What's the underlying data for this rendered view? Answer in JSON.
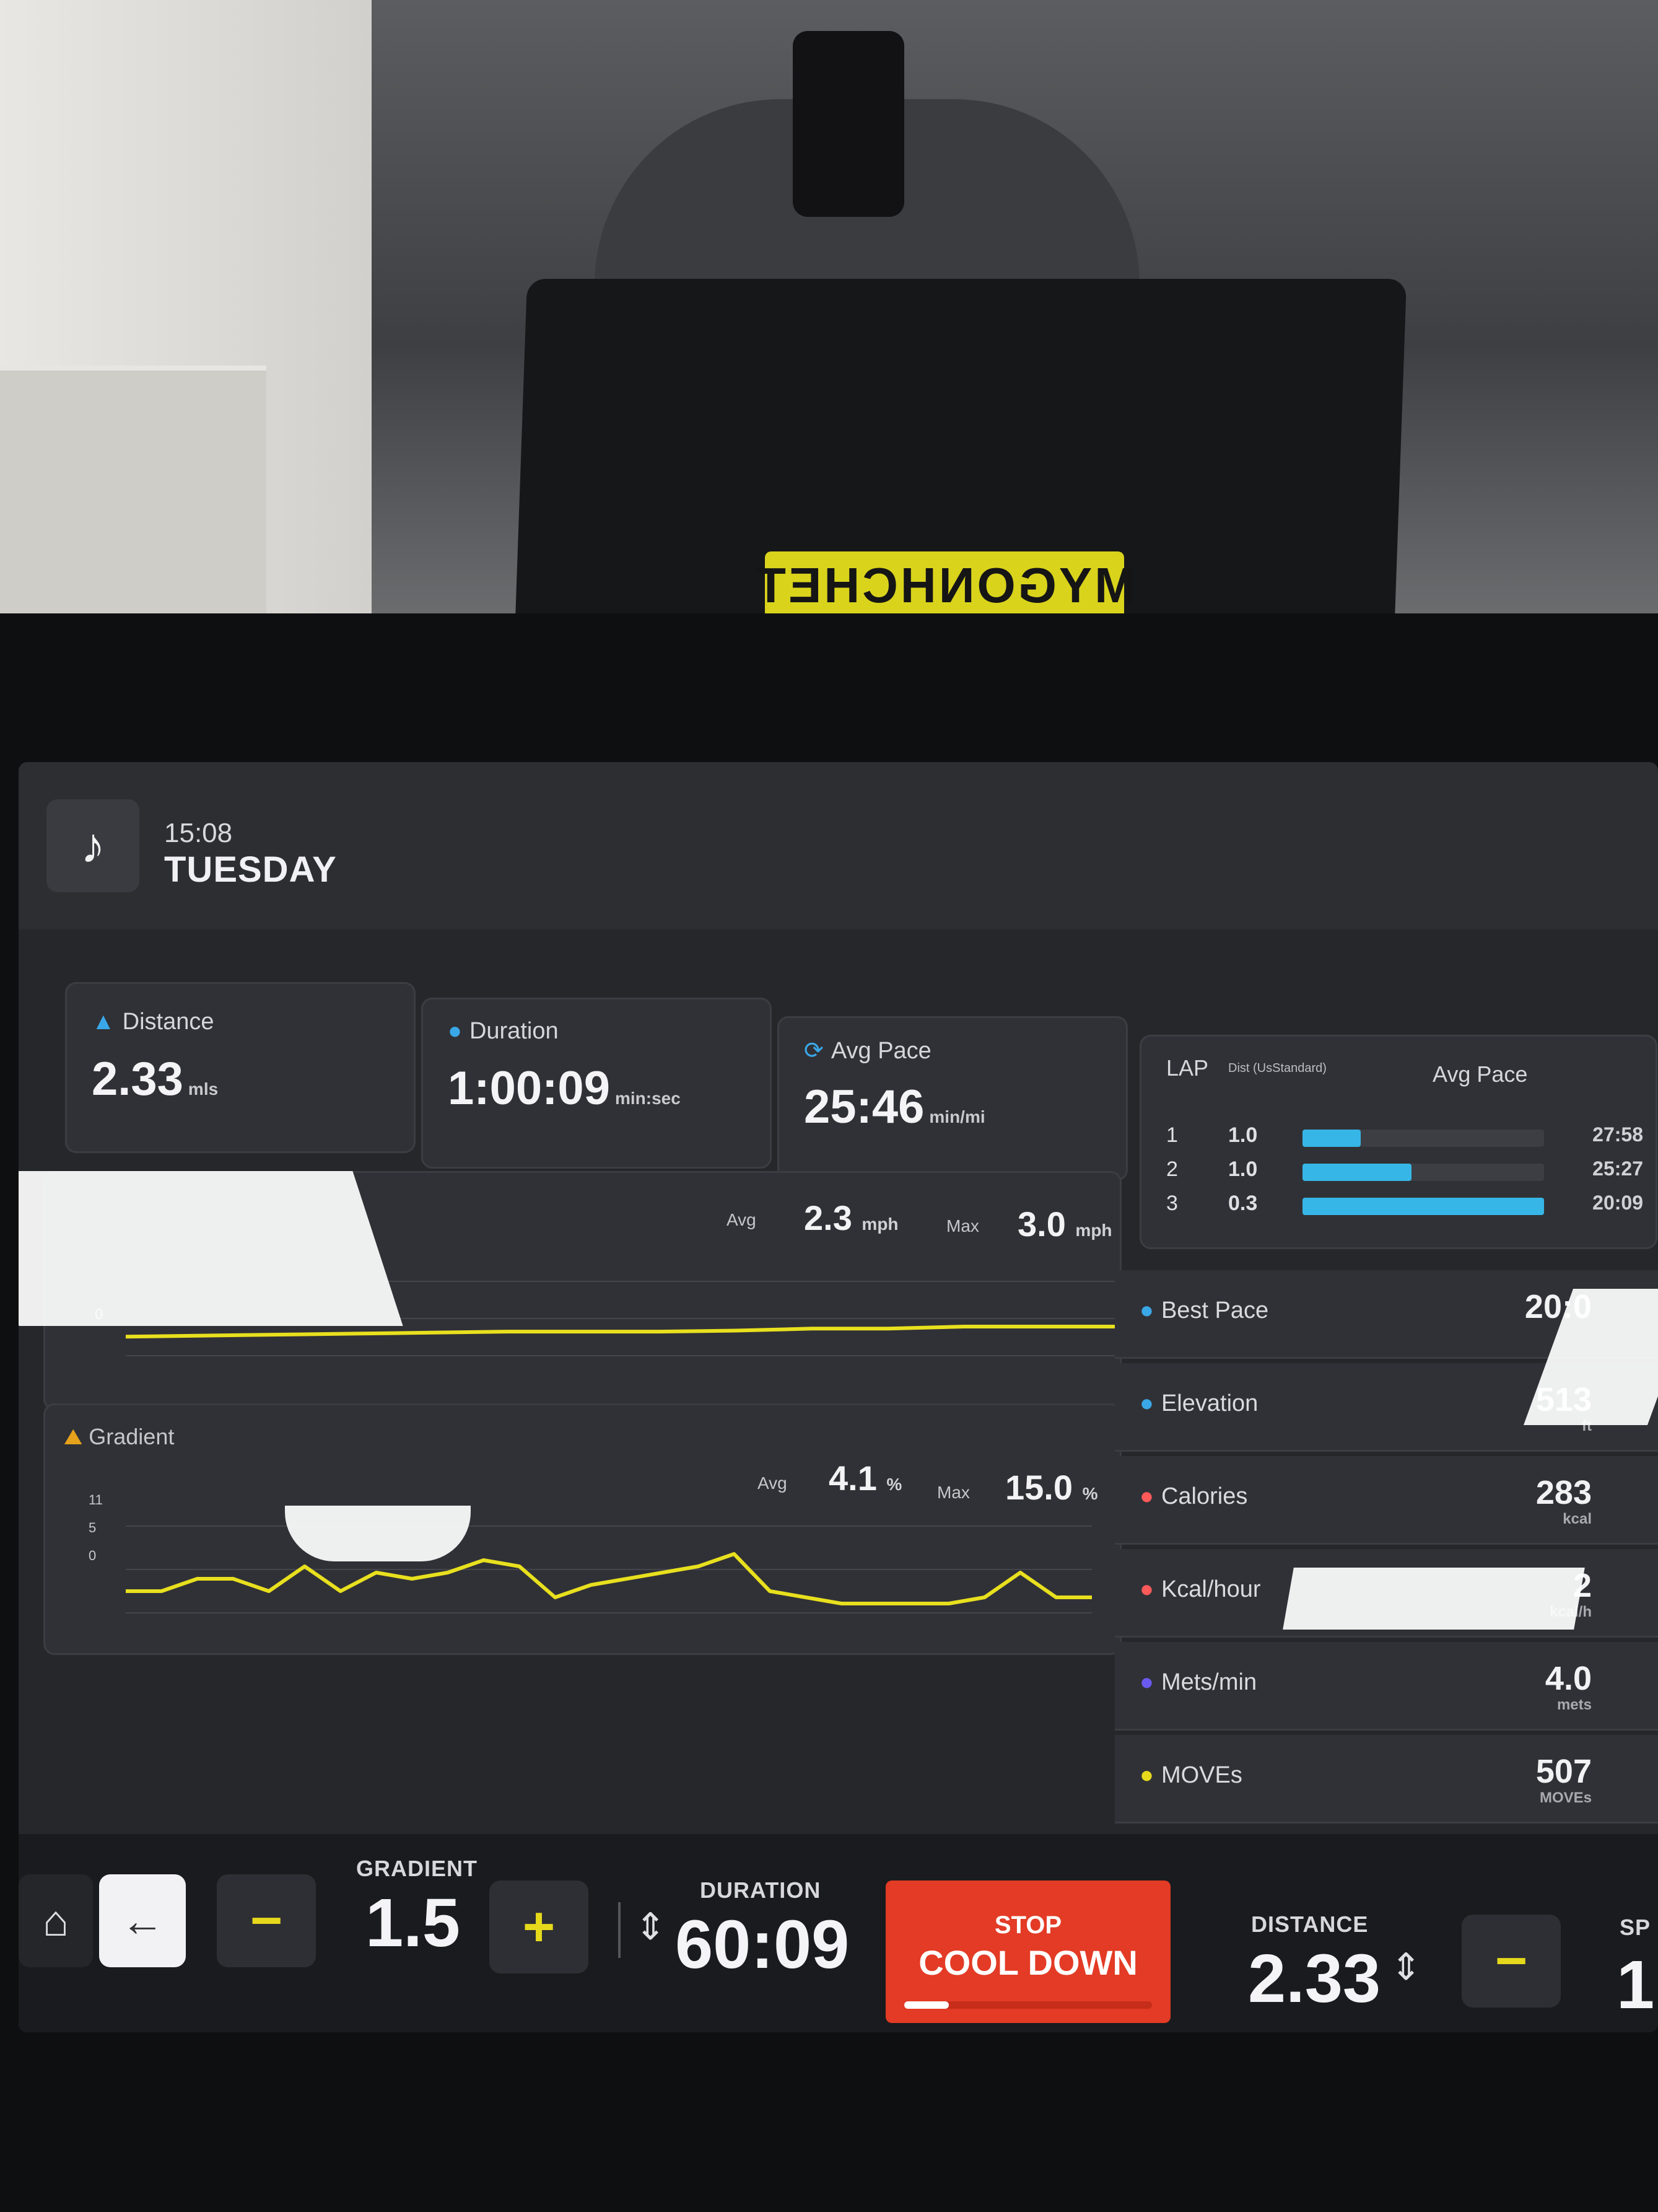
{
  "header": {
    "music_icon": "music-note-icon",
    "time": "15:08",
    "day": "TUESDAY"
  },
  "brand": {
    "label": "MYGONHCHET"
  },
  "metrics": {
    "distance": {
      "label": "Distance",
      "value": "2.33",
      "unit": "mls"
    },
    "duration": {
      "label": "Duration",
      "value": "1:00:09",
      "unit": "min:sec"
    },
    "avg_pace": {
      "label": "Avg Pace",
      "value": "25:46",
      "unit": "min/mi"
    }
  },
  "laps": {
    "col_lap": "LAP",
    "col_dist": "Dist (UsStandard)",
    "col_pace": "Avg Pace",
    "rows": [
      {
        "num": "1",
        "dist": "1.0",
        "pace": "27:58",
        "fill": 0.24
      },
      {
        "num": "2",
        "dist": "1.0",
        "pace": "25:27",
        "fill": 0.45
      },
      {
        "num": "3",
        "dist": "0.3",
        "pace": "20:09",
        "fill": 1.0
      }
    ]
  },
  "speed_chart": {
    "avg_label": "Avg",
    "avg_value": "2.3",
    "avg_unit": "mph",
    "max_label": "Max",
    "max_value": "3.0",
    "max_unit": "mph",
    "y_tick": "0"
  },
  "gradient_chart": {
    "title": "Gradient",
    "avg_label": "Avg",
    "avg_value": "4.1",
    "avg_unit": "%",
    "max_label": "Max",
    "max_value": "15.0",
    "max_unit": "%",
    "y_ticks": [
      "11",
      "5",
      "0"
    ]
  },
  "stats": [
    {
      "name": "Best Pace",
      "value": "20:0",
      "unit": "",
      "icon": "pace-icon",
      "color": "#3aa8e8"
    },
    {
      "name": "Elevation",
      "value": "513",
      "unit": "ft",
      "icon": "mountain-icon",
      "color": "#3aa8e8"
    },
    {
      "name": "Calories",
      "value": "283",
      "unit": "kcal",
      "icon": "flame-icon",
      "color": "#ff5a5a"
    },
    {
      "name": "Kcal/hour",
      "value": "2",
      "unit": "kcal/h",
      "icon": "flame-clock-icon",
      "color": "#ff5a5a"
    },
    {
      "name": "Mets/min",
      "value": "4.0",
      "unit": "mets",
      "icon": "mets-icon",
      "color": "#6a5af0"
    },
    {
      "name": "MOVEs",
      "value": "507",
      "unit": "MOVEs",
      "icon": "moves-dot-icon",
      "color": "#e6d91c"
    }
  ],
  "controls": {
    "gradient_label": "GRADIENT",
    "gradient_value": "1.5",
    "duration_label": "DURATION",
    "duration_value": "60:09",
    "stop_line1": "STOP",
    "stop_line2": "COOL DOWN",
    "distance_label": "DISTANCE",
    "distance_value": "2.33",
    "speed_label": "SP",
    "speed_value": "1."
  },
  "chart_data": [
    {
      "type": "line",
      "title": "",
      "series": [
        {
          "values": [
            0.1,
            0.15,
            0.2,
            0.25,
            0.3,
            0.35,
            0.35,
            0.35,
            0.4,
            0.5,
            0.5,
            0.6,
            0.6,
            0.6
          ]
        }
      ]
    },
    {
      "type": "line",
      "title": "Gradient",
      "series": [
        {
          "values": [
            0,
            0,
            2,
            2,
            0,
            4,
            0,
            3,
            2,
            3,
            5,
            4,
            -1,
            1,
            2,
            3,
            4,
            6,
            0,
            -1,
            -2,
            -2,
            -2,
            -2,
            -1,
            3,
            -1,
            -1
          ]
        }
      ]
    }
  ]
}
